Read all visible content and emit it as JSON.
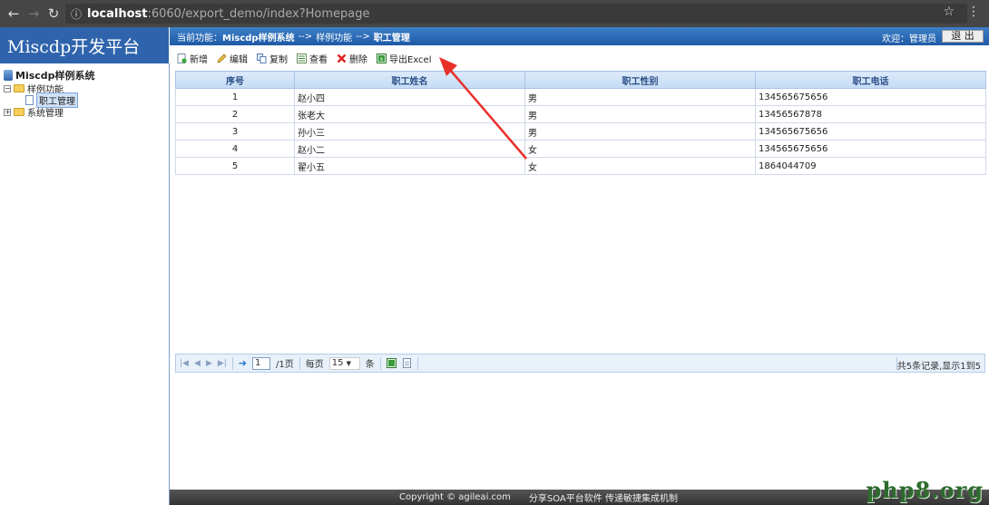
{
  "browser": {
    "url_host": "localhost",
    "url_rest": ":6060/export_demo/index?Homepage"
  },
  "app": {
    "logo": "Miscdp开发平台",
    "breadcrumb_prefix": "当前功能：",
    "breadcrumb_system": "Miscdp样例系统",
    "breadcrumb_sep1": "-->",
    "breadcrumb_module": "样例功能",
    "breadcrumb_sep2": "-->",
    "breadcrumb_page": "职工管理",
    "welcome": "欢迎：管理员",
    "logout": "退 出"
  },
  "tree": {
    "root": "Miscdp样例系统",
    "items": [
      {
        "label": "样例功能",
        "sign": "−"
      },
      {
        "label": "职工管理"
      },
      {
        "label": "系统管理",
        "sign": "+"
      }
    ]
  },
  "toolbar": {
    "add": "新增",
    "edit": "编辑",
    "copy": "复制",
    "view": "查看",
    "delete": "删除",
    "export": "导出Excel"
  },
  "grid": {
    "columns": [
      "序号",
      "职工姓名",
      "职工性别",
      "职工电话"
    ],
    "rows": [
      [
        "1",
        "赵小四",
        "男",
        "134565675656"
      ],
      [
        "2",
        "张老大",
        "男",
        "13456567878"
      ],
      [
        "3",
        "孙小三",
        "男",
        "134565675656"
      ],
      [
        "4",
        "赵小二",
        "女",
        "134565675656"
      ],
      [
        "5",
        "翟小五",
        "女",
        "1864044709"
      ]
    ]
  },
  "pager": {
    "current_page": "1",
    "total_pages": "/1页",
    "per_page_label": "每页",
    "per_page": "15",
    "unit": "条",
    "summary": "共5条记录,显示1到5"
  },
  "footer": {
    "copyright": "Copyright © agileai.com",
    "slogan": "分享SOA平台软件 传递敏捷集成机制"
  },
  "watermark": "php8.org"
}
